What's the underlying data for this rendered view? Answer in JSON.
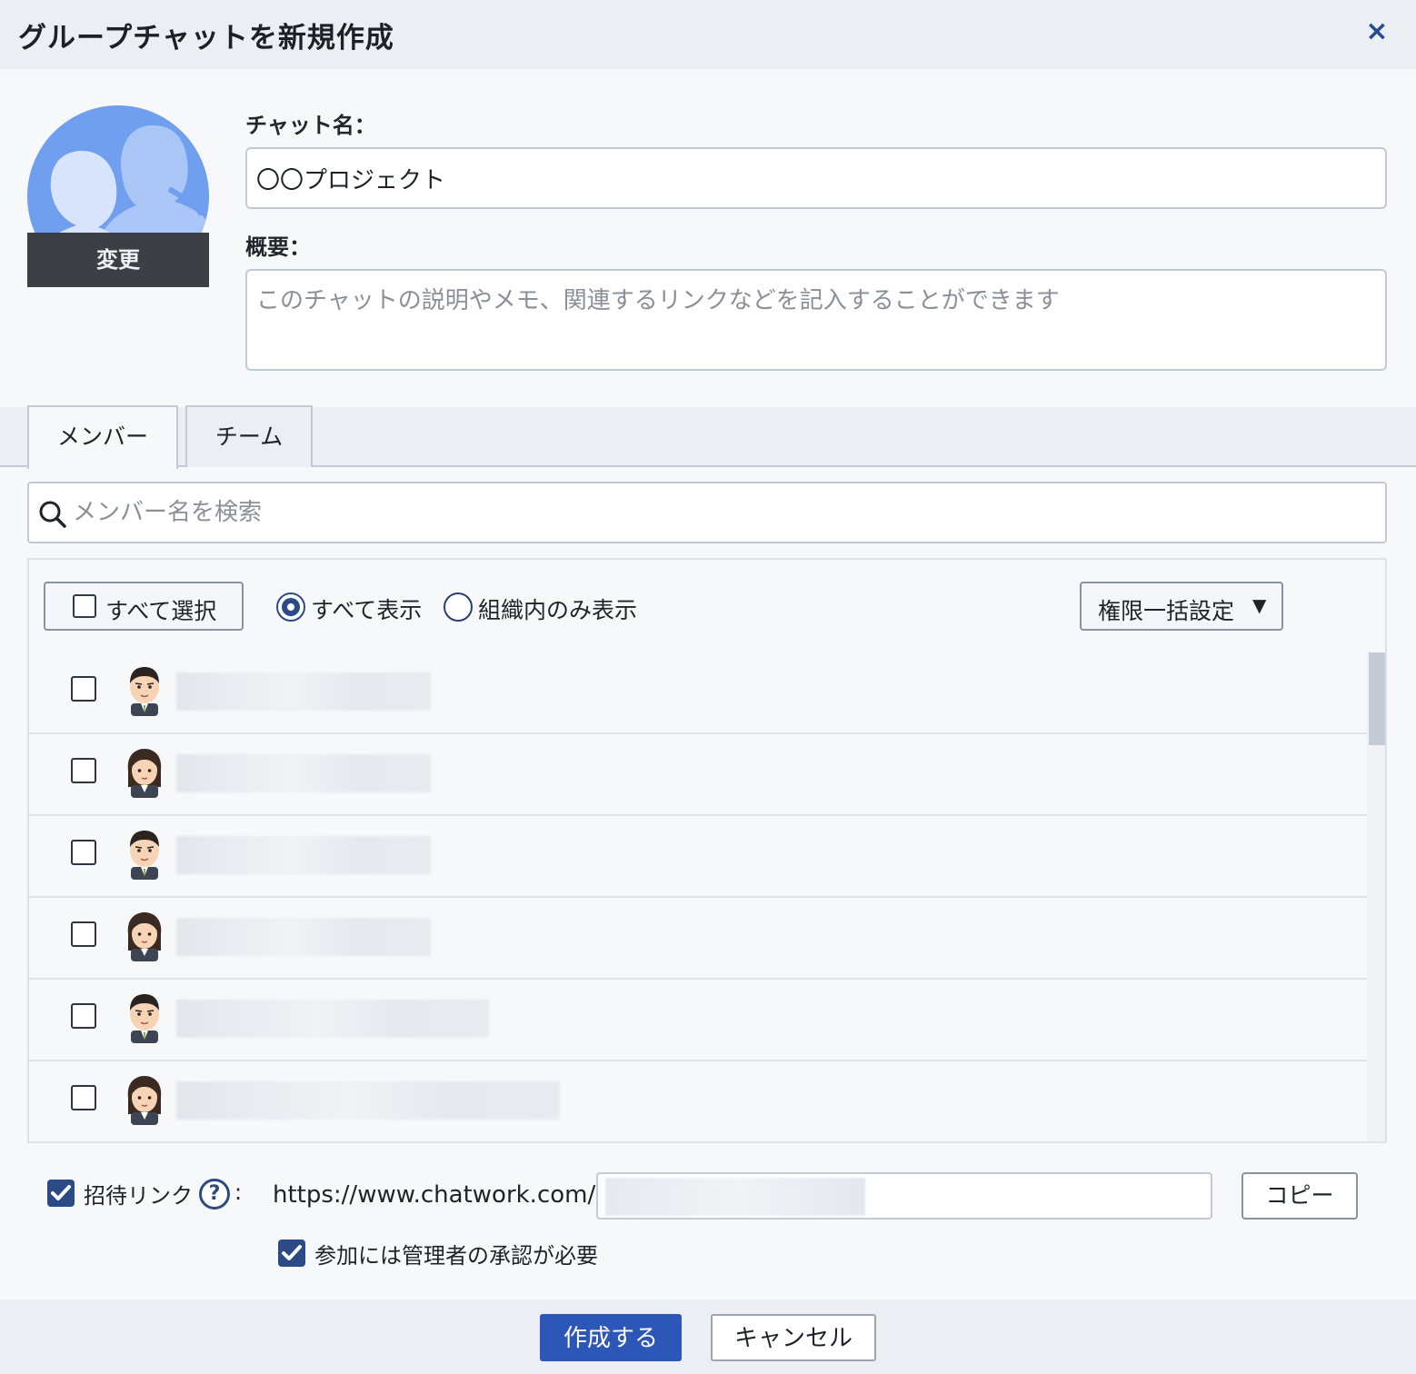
{
  "dialog": {
    "title": "グループチャットを新規作成",
    "close_label": "×"
  },
  "avatar": {
    "change_label": "変更"
  },
  "form": {
    "chat_name_label": "チャット名：",
    "chat_name_value": "〇〇プロジェクト",
    "summary_label": "概要：",
    "summary_placeholder": "このチャットの説明やメモ、関連するリンクなどを記入することができます"
  },
  "tabs": [
    {
      "label": "メンバー",
      "active": true
    },
    {
      "label": "チーム",
      "active": false
    }
  ],
  "search": {
    "placeholder": "メンバー名を検索",
    "icon": "search-icon"
  },
  "member_panel": {
    "select_all_label": "すべて選択",
    "filter_options": [
      {
        "label": "すべて表示",
        "selected": true
      },
      {
        "label": "組織内のみ表示",
        "selected": false
      }
    ],
    "bulk_permission_label": "権限一括設定",
    "bulk_permission_caret": "▼",
    "members": [
      {
        "avatar": "male-avatar-icon",
        "checked": false,
        "name_redacted": true
      },
      {
        "avatar": "female-avatar-icon",
        "checked": false,
        "name_redacted": true
      },
      {
        "avatar": "male-avatar-icon",
        "checked": false,
        "name_redacted": true
      },
      {
        "avatar": "female-avatar-icon",
        "checked": false,
        "name_redacted": true
      },
      {
        "avatar": "male-avatar-icon",
        "checked": false,
        "name_redacted": true
      },
      {
        "avatar": "female-avatar-icon",
        "checked": false,
        "name_redacted": true
      }
    ]
  },
  "invite": {
    "enabled": true,
    "label": "招待リンク",
    "help_icon_glyph": "?",
    "colon": ":",
    "url_prefix": "https://www.chatwork.com/g/",
    "copy_label": "コピー",
    "approval_required": true,
    "approval_label": "参加には管理者の承認が必要"
  },
  "footer": {
    "create_label": "作成する",
    "cancel_label": "キャンセル"
  },
  "colors": {
    "accent": "#2c4a85",
    "primary_button": "#2c56b8",
    "avatar_bg": "#6f9fee",
    "header_bg": "#ebeef3"
  }
}
